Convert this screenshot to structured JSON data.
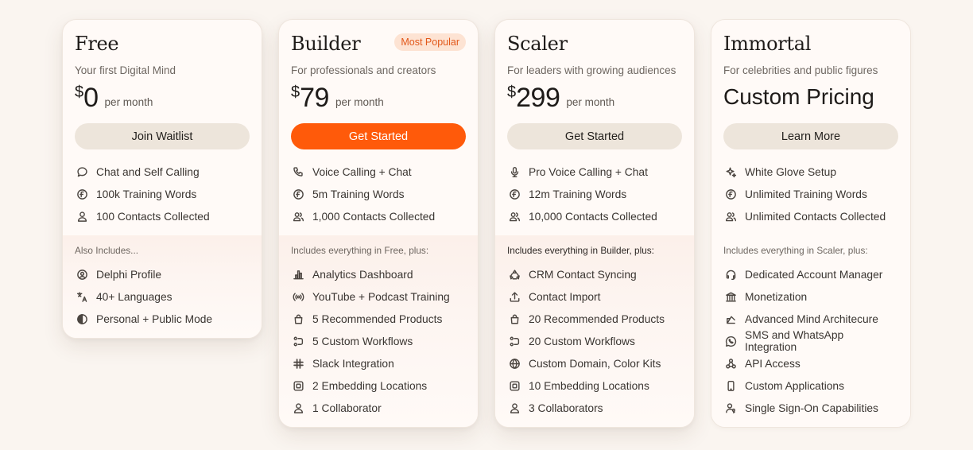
{
  "plans": [
    {
      "name": "Free",
      "tagline": "Your first Digital Mind",
      "currency": "$",
      "amount": "0",
      "period": "per month",
      "cta": "Join Waitlist",
      "features": [
        {
          "icon": "chat-bubble-icon",
          "label": "Chat and Self Calling"
        },
        {
          "icon": "training-words-icon",
          "label": "100k Training Words"
        },
        {
          "icon": "person-icon",
          "label": "100 Contacts Collected"
        }
      ],
      "includes_title": "Also Includes...",
      "includes": [
        {
          "icon": "profile-circle-icon",
          "label": "Delphi Profile"
        },
        {
          "icon": "translate-icon",
          "label": "40+ Languages"
        },
        {
          "icon": "half-circle-icon",
          "label": "Personal + Public Mode"
        }
      ]
    },
    {
      "name": "Builder",
      "badge": "Most Popular",
      "tagline": "For professionals and creators",
      "currency": "$",
      "amount": "79",
      "period": "per month",
      "cta": "Get Started",
      "features": [
        {
          "icon": "phone-icon",
          "label": "Voice Calling + Chat"
        },
        {
          "icon": "training-words-icon",
          "label": "5m Training Words"
        },
        {
          "icon": "people-icon",
          "label": "1,000 Contacts Collected"
        }
      ],
      "includes_title": "Includes everything in Free, plus:",
      "includes": [
        {
          "icon": "bar-chart-icon",
          "label": "Analytics Dashboard"
        },
        {
          "icon": "broadcast-icon",
          "label": "YouTube + Podcast Training"
        },
        {
          "icon": "shopping-bag-icon",
          "label": "5 Recommended Products"
        },
        {
          "icon": "workflow-icon",
          "label": "5 Custom Workflows"
        },
        {
          "icon": "slack-icon",
          "label": "Slack Integration"
        },
        {
          "icon": "embed-icon",
          "label": "2 Embedding Locations"
        },
        {
          "icon": "person-icon",
          "label": "1 Collaborator"
        }
      ]
    },
    {
      "name": "Scaler",
      "tagline": "For leaders with growing audiences",
      "currency": "$",
      "amount": "299",
      "period": "per month",
      "cta": "Get Started",
      "features": [
        {
          "icon": "microphone-icon",
          "label": "Pro Voice Calling + Chat"
        },
        {
          "icon": "training-words-icon",
          "label": "12m Training Words"
        },
        {
          "icon": "people-icon",
          "label": "10,000 Contacts Collected"
        }
      ],
      "includes_title": "Includes everything in Builder, plus:",
      "includes": [
        {
          "icon": "sync-icon",
          "label": "CRM Contact Syncing"
        },
        {
          "icon": "upload-icon",
          "label": "Contact Import"
        },
        {
          "icon": "shopping-bag-icon",
          "label": "20 Recommended Products"
        },
        {
          "icon": "workflow-icon",
          "label": "20 Custom Workflows"
        },
        {
          "icon": "globe-icon",
          "label": "Custom Domain, Color Kits"
        },
        {
          "icon": "embed-icon",
          "label": "10 Embedding Locations"
        },
        {
          "icon": "person-icon",
          "label": "3 Collaborators"
        }
      ]
    },
    {
      "name": "Immortal",
      "tagline": "For celebrities and public figures",
      "custom_price": "Custom Pricing",
      "cta": "Learn More",
      "features": [
        {
          "icon": "sparkle-icon",
          "label": "White Glove Setup"
        },
        {
          "icon": "training-words-icon",
          "label": "Unlimited Training Words"
        },
        {
          "icon": "people-icon",
          "label": "Unlimited Contacts Collected"
        }
      ],
      "includes_title": "Includes everything in Scaler, plus:",
      "includes": [
        {
          "icon": "headset-icon",
          "label": "Dedicated Account Manager"
        },
        {
          "icon": "bank-icon",
          "label": "Monetization"
        },
        {
          "icon": "architecture-icon",
          "label": "Advanced Mind Architecure"
        },
        {
          "icon": "whatsapp-icon",
          "label": "SMS and WhatsApp Integration"
        },
        {
          "icon": "api-icon",
          "label": "API Access"
        },
        {
          "icon": "mobile-icon",
          "label": "Custom Applications"
        },
        {
          "icon": "user-key-icon",
          "label": "Single Sign-On Capabilities"
        }
      ]
    }
  ],
  "colors": {
    "background": "#faf5f0",
    "card": "#fffaf7",
    "accent": "#ff5a0a",
    "badge_bg": "#fde3d3",
    "badge_text": "#e2581a",
    "button_neutral": "#ede5db"
  }
}
